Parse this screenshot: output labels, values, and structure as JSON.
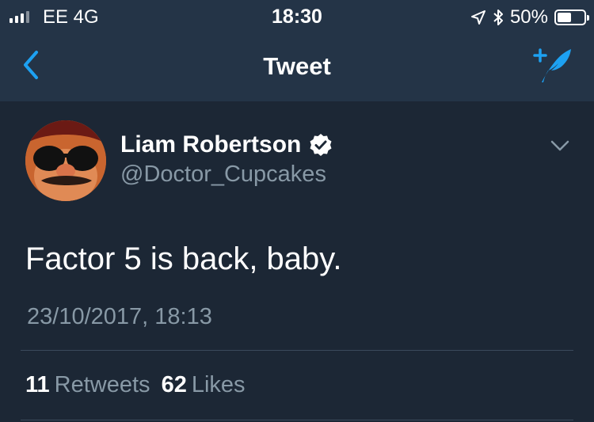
{
  "status_bar": {
    "carrier": "EE  4G",
    "time": "18:30",
    "battery": "50%",
    "battery_level": 0.5
  },
  "nav": {
    "title": "Tweet",
    "back_icon": "chevron-left-icon",
    "compose_icon": "compose-tweet-icon"
  },
  "tweet": {
    "author_name": "Liam Robertson",
    "verified": true,
    "handle": "@Doctor_Cupcakes",
    "text": "Factor 5 is back, baby.",
    "timestamp": "23/10/2017, 18:13",
    "retweets_count": "11",
    "retweets_label": "Retweets",
    "likes_count": "62",
    "likes_label": "Likes"
  },
  "colors": {
    "background": "#1c2735",
    "bar": "#243447",
    "accent": "#1da1f2",
    "secondary_text": "#8899a6"
  }
}
